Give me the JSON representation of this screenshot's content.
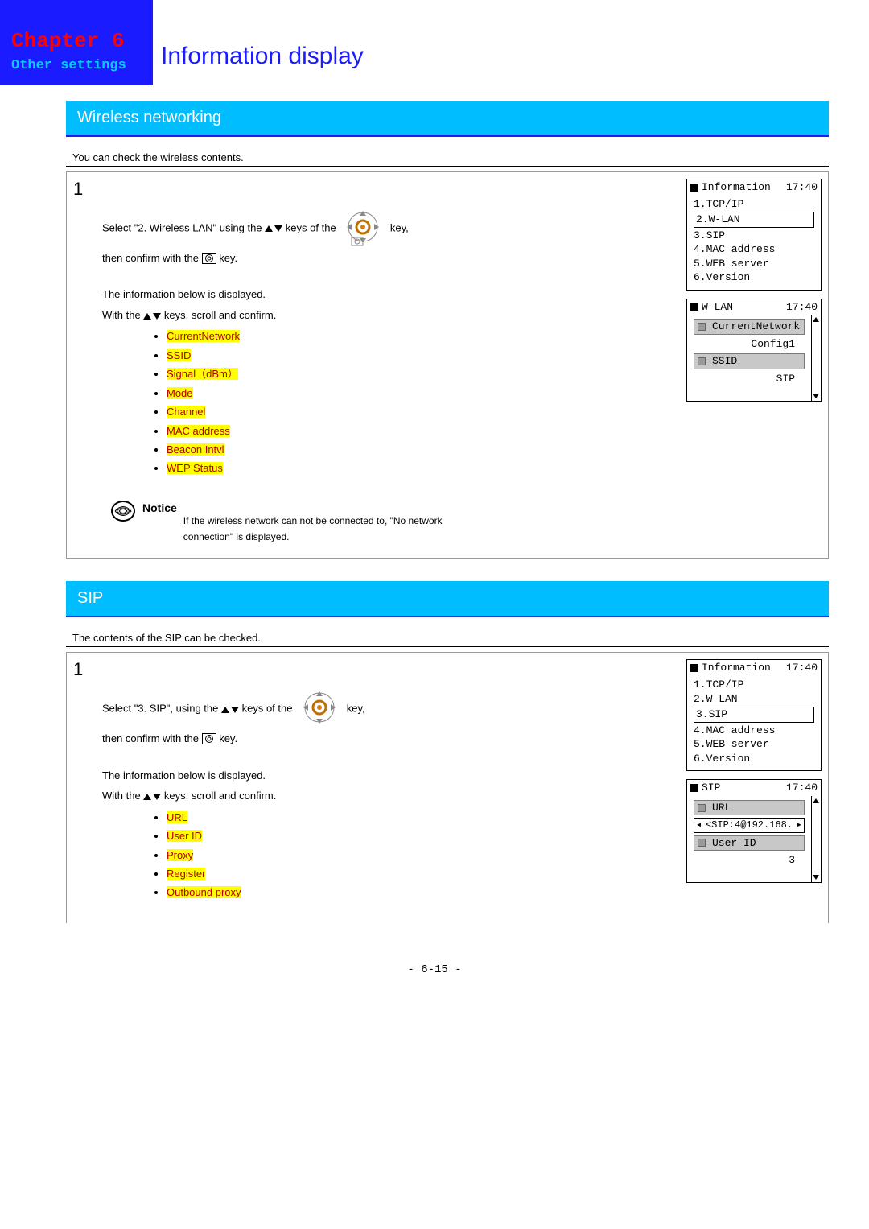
{
  "header": {
    "chapter": "Chapter 6",
    "other": "Other settings",
    "title": "Information display"
  },
  "sections": {
    "wireless": {
      "bar": "Wireless networking",
      "intro": "You can check the wireless contents.",
      "step_num": "1",
      "line1a": "Select \"2. Wireless LAN\" using the ",
      "line1b": " keys of the ",
      "line1c": " key,",
      "line2a": "then confirm with the ",
      "line2b": " key.",
      "info_disp": "The information below is displayed.",
      "scroll_a": "With the ",
      "scroll_b": " keys, scroll and confirm.",
      "items": [
        "CurrentNetwork",
        "SSID",
        "Signal（dBm）",
        "Mode",
        "Channel",
        "MAC address",
        "Beacon Intvl",
        "WEP Status"
      ],
      "notice_label": "Notice",
      "notice_text": "If the wireless network can not be connected to, \"No network connection\" is displayed."
    },
    "sip": {
      "bar": "SIP",
      "intro": "The contents of the SIP can be checked.",
      "step_num": "1",
      "line1a": "Select \"3. SIP\", using the ",
      "line1b": " keys of the ",
      "line1c": " key,",
      "line2a": "then confirm with the ",
      "line2b": " key.",
      "info_disp": "The information below is displayed.",
      "scroll_a": "With the ",
      "scroll_b": " keys, scroll and confirm.",
      "items": [
        "URL",
        "User ID",
        "Proxy",
        "Register",
        "Outbound proxy"
      ]
    }
  },
  "screens": {
    "info1": {
      "title": "Information",
      "time": "17:40",
      "lines": [
        "1.TCP/IP",
        "2.W-LAN",
        "3.SIP",
        "4.MAC address",
        "5.WEB server",
        "6.Version"
      ],
      "selected_index": 1
    },
    "wlan": {
      "title": "W-LAN",
      "time": "17:40",
      "rows": [
        {
          "label": "CurrentNetwork",
          "value": "Config1"
        },
        {
          "label": "SSID",
          "value": "SIP"
        }
      ]
    },
    "info2": {
      "title": "Information",
      "time": "17:40",
      "lines": [
        "1.TCP/IP",
        "2.W-LAN",
        "3.SIP",
        "4.MAC address",
        "5.WEB server",
        "6.Version"
      ],
      "selected_index": 2
    },
    "sip": {
      "title": "SIP",
      "time": "17:40",
      "rows": [
        {
          "label": "URL",
          "value": "<SIP:4@192.168.",
          "arrows": true
        },
        {
          "label": "User ID",
          "value": "3"
        }
      ]
    }
  },
  "footer": "- 6-15 -"
}
